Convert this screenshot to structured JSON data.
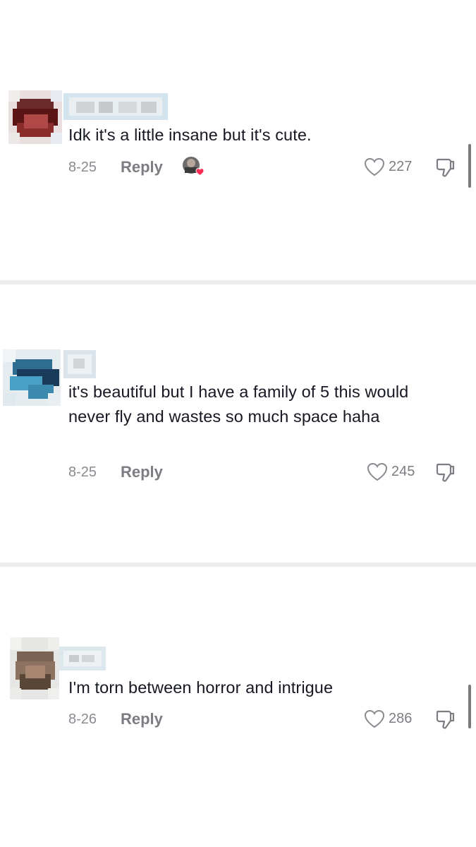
{
  "comments": [
    {
      "text": "Idk it's a little insane but it's cute.",
      "date": "8-25",
      "reply_label": "Reply",
      "likes": "227",
      "creator_liked": true
    },
    {
      "text": "it's beautiful but I have a family of 5 this would never fly and wastes so much space haha",
      "date": "8-25",
      "reply_label": "Reply",
      "likes": "245",
      "creator_liked": false
    },
    {
      "text": "I'm torn between horror and intrigue",
      "date": "8-26",
      "reply_label": "Reply",
      "likes": "286",
      "creator_liked": false
    }
  ],
  "icons": {
    "like": "heart-outline-icon",
    "dislike": "thumbs-down-icon",
    "creator_like": "creator-liked-heart-icon"
  },
  "colors": {
    "text": "#161823",
    "muted": "#8a8b91",
    "heart_badge": "#fe2c55",
    "divider": "#ececec"
  }
}
